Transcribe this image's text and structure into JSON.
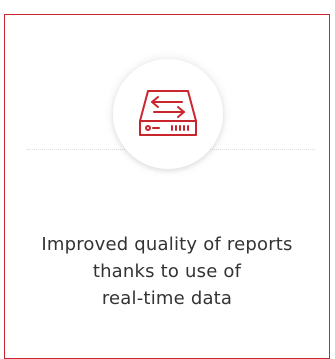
{
  "card": {
    "icon": "data-transfer-drive-icon",
    "accent_color": "#c9252c",
    "caption_lines": [
      "Improved quality of reports",
      "thanks to use of",
      "real-time data"
    ]
  }
}
